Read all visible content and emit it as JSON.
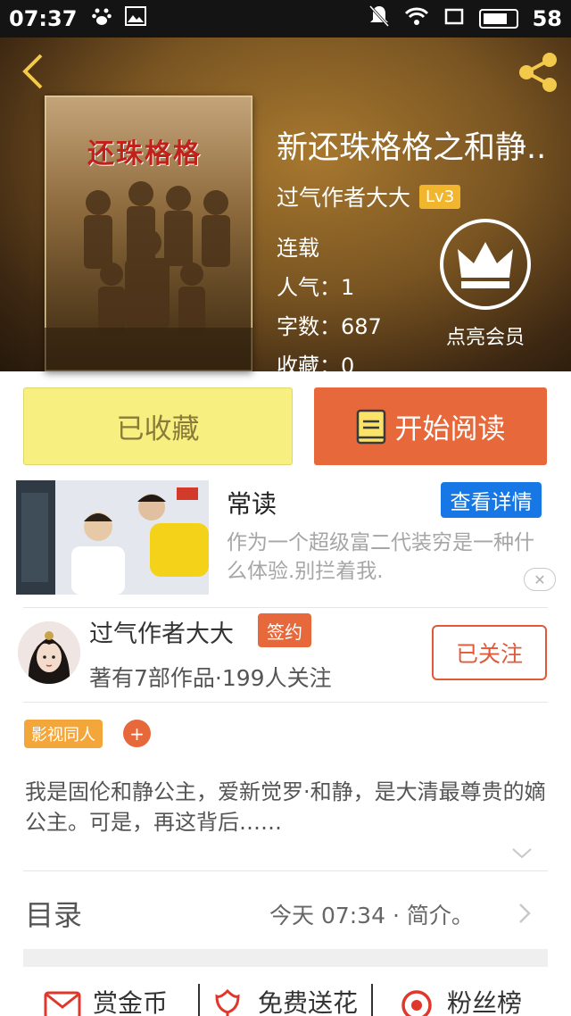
{
  "status_bar": {
    "time": "07:37",
    "battery": "58"
  },
  "book": {
    "title": "新还珠格格之和静..",
    "author": "过气作者大大",
    "level": "Lv3",
    "status": "连载",
    "popularity": "人气：1",
    "word_count": "字数：687",
    "favorites": "收藏：0",
    "cover_text": "还珠格格"
  },
  "vip": {
    "label": "点亮会员"
  },
  "actions": {
    "collected": "已收藏",
    "start_reading": "开始阅读"
  },
  "ad": {
    "title": "常读",
    "detail_button": "查看详情",
    "description": "作为一个超级富二代装穷是一种什么体验.别拦着我.",
    "close": "✕"
  },
  "author_card": {
    "name": "过气作者大大",
    "badge": "签约",
    "meta": "著有7部作品·199人关注",
    "follow_button": "已关注"
  },
  "tags": {
    "items": [
      "影视同人"
    ],
    "add": "+"
  },
  "intro": "我是固伦和静公主，爱新觉罗·和静，是大清最尊贵的嫡公主。可是，再这背后……",
  "toc": {
    "label": "目录",
    "update": "今天 07:34 · 简介。"
  },
  "bottom_actions": [
    {
      "label": "赏金币",
      "icon": "envelope-icon"
    },
    {
      "label": "免费送花",
      "icon": "flower-icon"
    },
    {
      "label": "粉丝榜",
      "icon": "fan-rank-icon"
    }
  ],
  "colors": {
    "accent_orange": "#e7683a",
    "fav_yellow": "#f7ef7f",
    "ad_blue": "#1778e5",
    "level_gold": "#f1b52e"
  }
}
